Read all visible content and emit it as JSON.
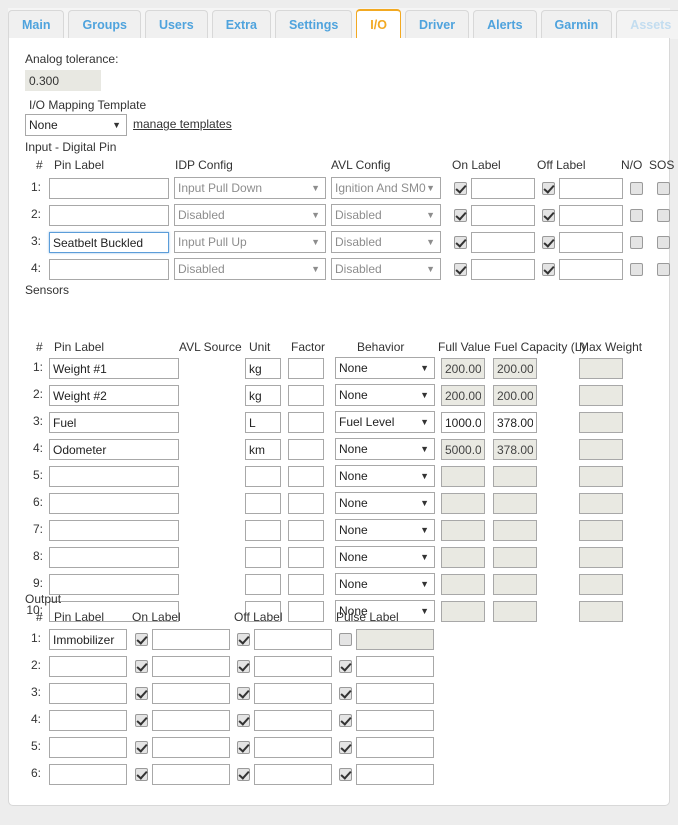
{
  "tabs": [
    {
      "label": "Main",
      "state": "normal"
    },
    {
      "label": "Groups",
      "state": "normal"
    },
    {
      "label": "Users",
      "state": "normal"
    },
    {
      "label": "Extra",
      "state": "normal"
    },
    {
      "label": "Settings",
      "state": "normal"
    },
    {
      "label": "I/O",
      "state": "active"
    },
    {
      "label": "Driver",
      "state": "normal"
    },
    {
      "label": "Alerts",
      "state": "normal"
    },
    {
      "label": "Garmin",
      "state": "normal"
    },
    {
      "label": "Assets",
      "state": "disabled"
    }
  ],
  "analog": {
    "label": "Analog tolerance:",
    "value": "0.300"
  },
  "mapping": {
    "label": "I/O Mapping Template",
    "selected": "None",
    "options": [
      "None"
    ],
    "manage_link": "manage templates"
  },
  "digital": {
    "title": "Input - Digital Pin",
    "headers": {
      "num": "#",
      "pin_label": "Pin Label",
      "idp_config": "IDP Config",
      "avl_config": "AVL Config",
      "on_label": "On Label",
      "off_label": "Off Label",
      "no": "N/O",
      "sos": "SOS"
    },
    "rows": [
      {
        "n": "1:",
        "pin_label": "",
        "idp_config": "Input Pull Down",
        "avl_config": "Ignition And SM0",
        "on_checked": true,
        "on_label": "",
        "off_checked": true,
        "off_label": "",
        "no": false,
        "sos": false,
        "focused": false
      },
      {
        "n": "2:",
        "pin_label": "",
        "idp_config": "Disabled",
        "avl_config": "Disabled",
        "on_checked": true,
        "on_label": "",
        "off_checked": true,
        "off_label": "",
        "no": false,
        "sos": false,
        "focused": false
      },
      {
        "n": "3:",
        "pin_label": "Seatbelt Buckled",
        "idp_config": "Input Pull Up",
        "avl_config": "Disabled",
        "on_checked": true,
        "on_label": "",
        "off_checked": true,
        "off_label": "",
        "no": false,
        "sos": false,
        "focused": true
      },
      {
        "n": "4:",
        "pin_label": "",
        "idp_config": "Disabled",
        "avl_config": "Disabled",
        "on_checked": true,
        "on_label": "",
        "off_checked": true,
        "off_label": "",
        "no": false,
        "sos": false,
        "focused": false
      }
    ]
  },
  "sensors": {
    "title": "Sensors",
    "headers": {
      "num": "#",
      "pin_label": "Pin Label",
      "avl_source": "AVL Source",
      "unit": "Unit",
      "factor": "Factor",
      "behavior": "Behavior",
      "full_value": "Full Value",
      "fuel_capacity": "Fuel Capacity (L)",
      "max_weight": "Max Weight"
    },
    "rows": [
      {
        "n": "1:",
        "pin_label": "Weight #1",
        "unit": "kg",
        "factor": "",
        "behavior": "None",
        "full_value": "200.000",
        "full_disabled": true,
        "fuel_capacity": "200.000",
        "fuel_disabled": true,
        "max_weight": "",
        "max_disabled": true
      },
      {
        "n": "2:",
        "pin_label": "Weight #2",
        "unit": "kg",
        "factor": "",
        "behavior": "None",
        "full_value": "200.000",
        "full_disabled": true,
        "fuel_capacity": "200.000",
        "fuel_disabled": true,
        "max_weight": "",
        "max_disabled": true
      },
      {
        "n": "3:",
        "pin_label": "Fuel",
        "unit": "L",
        "factor": "",
        "behavior": "Fuel Level",
        "full_value": "1000.000",
        "full_disabled": false,
        "fuel_capacity": "378.000",
        "fuel_disabled": false,
        "max_weight": "",
        "max_disabled": true
      },
      {
        "n": "4:",
        "pin_label": "Odometer",
        "unit": "km",
        "factor": "",
        "behavior": "None",
        "full_value": "5000.000",
        "full_disabled": true,
        "fuel_capacity": "378.000",
        "fuel_disabled": true,
        "max_weight": "",
        "max_disabled": true
      },
      {
        "n": "5:",
        "pin_label": "",
        "unit": "",
        "factor": "",
        "behavior": "None",
        "full_value": "",
        "full_disabled": true,
        "fuel_capacity": "",
        "fuel_disabled": true,
        "max_weight": "",
        "max_disabled": true
      },
      {
        "n": "6:",
        "pin_label": "",
        "unit": "",
        "factor": "",
        "behavior": "None",
        "full_value": "",
        "full_disabled": true,
        "fuel_capacity": "",
        "fuel_disabled": true,
        "max_weight": "",
        "max_disabled": true
      },
      {
        "n": "7:",
        "pin_label": "",
        "unit": "",
        "factor": "",
        "behavior": "None",
        "full_value": "",
        "full_disabled": true,
        "fuel_capacity": "",
        "fuel_disabled": true,
        "max_weight": "",
        "max_disabled": true
      },
      {
        "n": "8:",
        "pin_label": "",
        "unit": "",
        "factor": "",
        "behavior": "None",
        "full_value": "",
        "full_disabled": true,
        "fuel_capacity": "",
        "fuel_disabled": true,
        "max_weight": "",
        "max_disabled": true
      },
      {
        "n": "9:",
        "pin_label": "",
        "unit": "",
        "factor": "",
        "behavior": "None",
        "full_value": "",
        "full_disabled": true,
        "fuel_capacity": "",
        "fuel_disabled": true,
        "max_weight": "",
        "max_disabled": true
      },
      {
        "n": "10:",
        "pin_label": "",
        "unit": "",
        "factor": "",
        "behavior": "None",
        "full_value": "",
        "full_disabled": true,
        "fuel_capacity": "",
        "fuel_disabled": true,
        "max_weight": "",
        "max_disabled": true
      }
    ]
  },
  "output": {
    "title": "Output",
    "headers": {
      "num": "#",
      "pin_label": "Pin Label",
      "on_label": "On Label",
      "off_label": "Off Label",
      "pulse_label": "Pulse Label"
    },
    "rows": [
      {
        "n": "1:",
        "pin_label": "Immobilizer",
        "on_checked": true,
        "on_label": "",
        "off_checked": true,
        "off_label": "",
        "pulse_checked": false,
        "pulse_label": "",
        "pulse_disabled": true
      },
      {
        "n": "2:",
        "pin_label": "",
        "on_checked": true,
        "on_label": "",
        "off_checked": true,
        "off_label": "",
        "pulse_checked": true,
        "pulse_label": "",
        "pulse_disabled": false
      },
      {
        "n": "3:",
        "pin_label": "",
        "on_checked": true,
        "on_label": "",
        "off_checked": true,
        "off_label": "",
        "pulse_checked": true,
        "pulse_label": "",
        "pulse_disabled": false
      },
      {
        "n": "4:",
        "pin_label": "",
        "on_checked": true,
        "on_label": "",
        "off_checked": true,
        "off_label": "",
        "pulse_checked": true,
        "pulse_label": "",
        "pulse_disabled": false
      },
      {
        "n": "5:",
        "pin_label": "",
        "on_checked": true,
        "on_label": "",
        "off_checked": true,
        "off_label": "",
        "pulse_checked": true,
        "pulse_label": "",
        "pulse_disabled": false
      },
      {
        "n": "6:",
        "pin_label": "",
        "on_checked": true,
        "on_label": "",
        "off_checked": true,
        "off_label": "",
        "pulse_checked": true,
        "pulse_label": "",
        "pulse_disabled": false
      }
    ]
  },
  "colors": {
    "tab_text": "#4fa3dd",
    "tab_active": "#f2a922",
    "panel_bg": "#ffffff",
    "page_bg": "#ededed",
    "disabled_field": "#e9e9e2"
  }
}
